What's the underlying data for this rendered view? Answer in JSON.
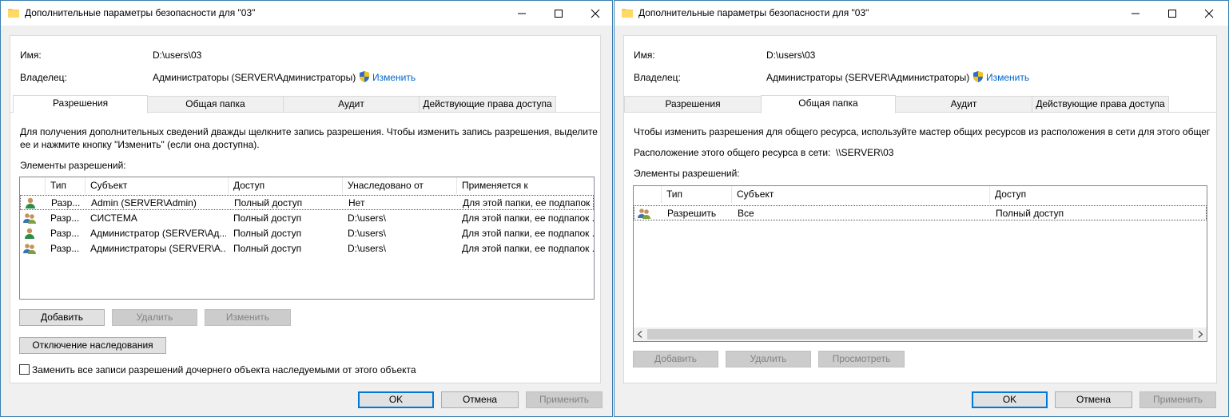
{
  "left": {
    "title": "Дополнительные параметры безопасности  для \"03\"",
    "name_label": "Имя:",
    "name_value": "D:\\users\\03",
    "owner_label": "Владелец:",
    "owner_value": "Администраторы (SERVER\\Администраторы)",
    "change_link": "Изменить",
    "tabs": [
      "Разрешения",
      "Общая папка",
      "Аудит",
      "Действующие права доступа"
    ],
    "active_tab": "Разрешения",
    "info_line1": "Для получения дополнительных сведений дважды щелкните запись разрешения. Чтобы изменить запись разрешения, выделите",
    "info_line2": "ее и нажмите кнопку \"Изменить\" (если она доступна).",
    "list_label": "Элементы разрешений:",
    "columns": [
      "Тип",
      "Субъект",
      "Доступ",
      "Унаследовано от",
      "Применяется к"
    ],
    "rows": [
      {
        "icon": "user-icon",
        "type": "Разр...",
        "subject": "Admin (SERVER\\Admin)",
        "access": "Полный доступ",
        "inherited": "Нет",
        "applies": "Для этой папки, ее подпапок ..."
      },
      {
        "icon": "group-icon",
        "type": "Разр...",
        "subject": "СИСТЕМА",
        "access": "Полный доступ",
        "inherited": "D:\\users\\",
        "applies": "Для этой папки, ее подпапок ..."
      },
      {
        "icon": "user-icon",
        "type": "Разр...",
        "subject": "Администратор (SERVER\\Ад...",
        "access": "Полный доступ",
        "inherited": "D:\\users\\",
        "applies": "Для этой папки, ее подпапок ..."
      },
      {
        "icon": "group-icon",
        "type": "Разр...",
        "subject": "Администраторы (SERVER\\А...",
        "access": "Полный доступ",
        "inherited": "D:\\users\\",
        "applies": "Для этой папки, ее подпапок ..."
      }
    ],
    "add_button": "Добавить",
    "remove_button": "Удалить",
    "edit_button": "Изменить",
    "disable_inheritance_button": "Отключение наследования",
    "replace_checkbox_label": "Заменить все записи разрешений дочернего объекта наследуемыми от этого объекта",
    "replace_checked": false,
    "ok_button": "OK",
    "cancel_button": "Отмена",
    "apply_button": "Применить"
  },
  "right": {
    "title": "Дополнительные параметры безопасности  для \"03\"",
    "name_label": "Имя:",
    "name_value": "D:\\users\\03",
    "owner_label": "Владелец:",
    "owner_value": "Администраторы (SERVER\\Администраторы)",
    "change_link": "Изменить",
    "tabs": [
      "Разрешения",
      "Общая папка",
      "Аудит",
      "Действующие права доступа"
    ],
    "active_tab": "Общая папка",
    "info_line1": "Чтобы изменить разрешения для общего ресурса, используйте мастер общих ресурсов из расположения в сети для этого общег",
    "location_label": "Расположение этого общего ресурса в сети:",
    "location_value": "\\\\SERVER\\03",
    "list_label": "Элементы разрешений:",
    "columns": [
      "Тип",
      "Субъект",
      "Доступ"
    ],
    "rows": [
      {
        "icon": "group-icon",
        "type": "Разрешить",
        "subject": "Все",
        "access": "Полный доступ"
      }
    ],
    "add_button": "Добавить",
    "remove_button": "Удалить",
    "view_button": "Просмотреть",
    "ok_button": "OK",
    "cancel_button": "Отмена",
    "apply_button": "Применить"
  },
  "colors": {
    "link": "#0066cc",
    "window_border": "#3c7fb1",
    "default_button_border": "#0078d7"
  }
}
